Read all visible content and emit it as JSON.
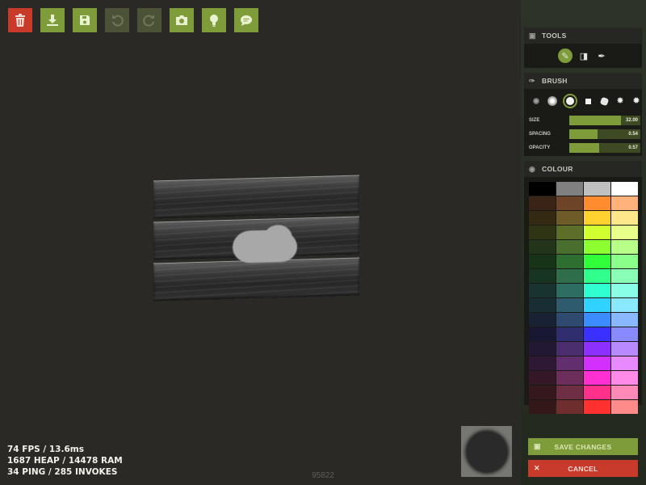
{
  "toolbar": {
    "buttons": [
      {
        "name": "trash-icon",
        "variant": "danger"
      },
      {
        "name": "download-icon",
        "variant": "primary"
      },
      {
        "name": "save-icon",
        "variant": "primary"
      },
      {
        "name": "undo-icon",
        "variant": "disabled"
      },
      {
        "name": "redo-icon",
        "variant": "disabled"
      },
      {
        "name": "camera-icon",
        "variant": "primary"
      },
      {
        "name": "lightbulb-icon",
        "variant": "primary"
      },
      {
        "name": "chat-icon",
        "variant": "primary"
      }
    ]
  },
  "stats": {
    "fps_line": "74 FPS / 13.6ms",
    "memory_line": "1687 HEAP / 14478 RAM",
    "network_line": "34 PING / 285 INVOKES"
  },
  "counter": "95822",
  "tools_panel": {
    "title": "TOOLS",
    "tools": [
      {
        "name": "brush-tool-icon",
        "active": true
      },
      {
        "name": "eraser-tool-icon",
        "active": false
      },
      {
        "name": "eyedropper-tool-icon",
        "active": false
      }
    ]
  },
  "brush_panel": {
    "title": "BRUSH",
    "size": {
      "label": "SIZE",
      "value": "32.00",
      "fraction": 0.73
    },
    "spacing": {
      "label": "SPACING",
      "value": "0.54",
      "fraction": 0.4
    },
    "opacity": {
      "label": "OPACITY",
      "value": "0.57",
      "fraction": 0.42
    }
  },
  "colour_panel": {
    "title": "COLOUR",
    "palette": [
      "#000000",
      "#808080",
      "#c0c0c0",
      "#ffffff",
      "#3a2418",
      "#6e4428",
      "#ff8c2e",
      "#ffb27a",
      "#342a14",
      "#6e5c28",
      "#ffd230",
      "#ffe88a",
      "#2e3414",
      "#5c6e28",
      "#d2ff30",
      "#e8ff8a",
      "#22341a",
      "#4a6e2e",
      "#8cff30",
      "#b8ff8a",
      "#183418",
      "#2e6e30",
      "#30ff3a",
      "#8aff8a",
      "#183422",
      "#2e6e4a",
      "#30ff8c",
      "#8affb8",
      "#183430",
      "#2e6e62",
      "#30ffd2",
      "#8affe8",
      "#182e34",
      "#2e5c6e",
      "#30d2ff",
      "#8ae8ff",
      "#182234",
      "#2e4a6e",
      "#3a8cff",
      "#8ab8ff",
      "#181834",
      "#302e6e",
      "#3a30ff",
      "#8a8aff",
      "#221834",
      "#4a2e6e",
      "#8c30ff",
      "#b88aff",
      "#2e1834",
      "#622e6e",
      "#d230ff",
      "#e88aff",
      "#341828",
      "#6e2e5c",
      "#ff30d2",
      "#ff8ae8",
      "#34181e",
      "#6e2e44",
      "#ff308c",
      "#ff8ab8",
      "#341818",
      "#6e2e2e",
      "#ff3030",
      "#ff8a8a"
    ]
  },
  "actions": {
    "save_label": "SAVE CHANGES",
    "cancel_label": "CANCEL"
  }
}
